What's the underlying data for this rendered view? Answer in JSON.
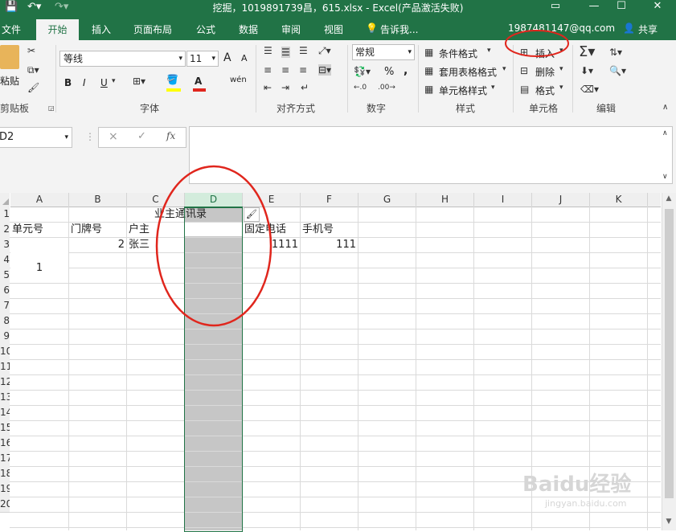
{
  "titlebar": {
    "title": "挖掘，1019891739昌，615.xlsx - Excel(产品激活失败)",
    "save_icon": "save-icon",
    "undo_icon": "undo-icon",
    "redo_icon": "redo-icon",
    "win_icons": [
      "ribbon-display-icon",
      "minimize-icon",
      "restore-icon",
      "close-icon"
    ]
  },
  "tabs": {
    "file": "文件",
    "home": "开始",
    "insert": "插入",
    "page_layout": "页面布局",
    "formulas": "公式",
    "data": "数据",
    "review": "审阅",
    "view": "视图",
    "tell_me": "告诉我...",
    "account": "1987481147@qq.com",
    "share": "共享"
  },
  "ribbon": {
    "clipboard": {
      "paste": "粘贴",
      "label": "剪贴板"
    },
    "font": {
      "name": "等线",
      "size": "11",
      "label": "字体",
      "bold": "B",
      "italic": "I",
      "underline": "U",
      "grow": "A",
      "shrink": "A",
      "wen": "wén"
    },
    "alignment": {
      "label": "对齐方式"
    },
    "number": {
      "format": "常规",
      "label": "数字",
      "percent": "%",
      "comma": ","
    },
    "styles": {
      "conditional": "条件格式",
      "table": "套用表格格式",
      "cell_styles": "单元格样式",
      "label": "样式"
    },
    "cells": {
      "insert": "插入",
      "delete": "删除",
      "format": "格式",
      "label": "单元格"
    },
    "editing": {
      "label": "编辑"
    }
  },
  "formula_bar": {
    "name_box": "D2",
    "cancel": "×",
    "enter": "✓",
    "fx": "fx",
    "formula": ""
  },
  "sheet": {
    "columns": [
      "A",
      "B",
      "C",
      "D",
      "E",
      "F",
      "G",
      "H",
      "I",
      "J",
      "K"
    ],
    "rows": [
      "1",
      "2",
      "3",
      "4",
      "5",
      "6",
      "7",
      "8",
      "9",
      "10",
      "11",
      "12",
      "13",
      "14",
      "15",
      "16",
      "17",
      "18",
      "19",
      "20"
    ],
    "cells": {
      "c1": "业主通讯录",
      "a2": "单元号",
      "b2": "门牌号",
      "c2": "户主",
      "e2": "固定电话",
      "f2": "手机号",
      "b3": "2",
      "c3": "张三",
      "e3": "1111",
      "f3": "111",
      "a4": "1"
    },
    "selected_column": "D",
    "selection_color": "#c6c6c6",
    "selection_border": "#217346",
    "annotation_color": "#e0261d"
  },
  "watermark": {
    "text": "Baidu经验",
    "url": "jingyan.baidu.com"
  },
  "colors": {
    "excel_green": "#217346",
    "ribbon_bg": "#f3f3f3"
  }
}
